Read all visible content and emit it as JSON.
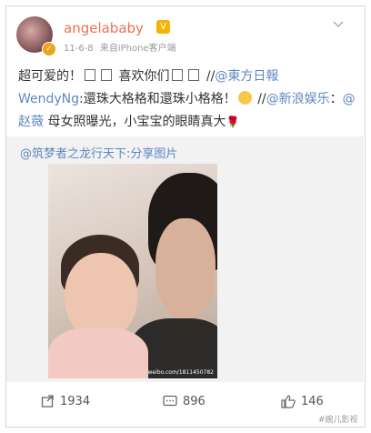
{
  "post": {
    "username": "angelababy",
    "date": "11-6-8",
    "source": "来自iPhone客户端",
    "text": {
      "part1": "超可爱的！",
      "part2": "喜欢你们",
      "part3": "//",
      "mention1": "@東方日報",
      "mention2": "WendyNg",
      "part4": ":還珠大格格和還珠小格格！",
      "part5": "//",
      "mention3": "@新浪娱乐",
      "part6": "：",
      "mention4": "@赵薇",
      "part7": "母女照曝光，小宝宝的眼睛真大"
    }
  },
  "repost": {
    "header": "@筑梦者之龙行天下:分享图片",
    "image_watermark": "weibo.com/1811450782"
  },
  "actions": {
    "repost_count": "1934",
    "comment_count": "896",
    "like_count": "146"
  },
  "corner_watermark": "#婉儿影视",
  "colors": {
    "username": "#eb7350",
    "link": "#5d87c3"
  }
}
